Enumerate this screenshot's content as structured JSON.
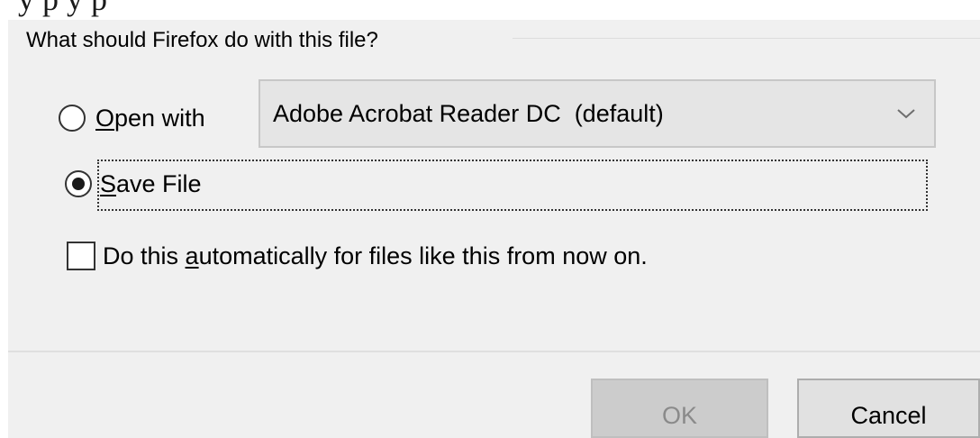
{
  "top_fragment": "            y                                                   p    y          p",
  "dialog": {
    "group_title": "What should Firefox do with this file?",
    "open_with": {
      "mnemonic": "O",
      "rest": "pen with",
      "selected": false,
      "app_value": "Adobe Acrobat Reader DC  (default)",
      "chevron_icon": "chevron-down-icon"
    },
    "save_file": {
      "mnemonic": "S",
      "rest": "ave File",
      "selected": true
    },
    "auto": {
      "before": "Do this ",
      "mnemonic": "a",
      "after": "utomatically for files like this from now on.",
      "checked": false
    },
    "buttons": {
      "ok_label": "OK",
      "ok_enabled": false,
      "cancel_label": "Cancel"
    }
  },
  "colors": {
    "dialog_bg": "#f0f0f0",
    "dropdown_bg": "#e5e5e5",
    "ok_disabled_bg": "#cccccc",
    "ok_disabled_text": "#8a8a8a",
    "cancel_bg": "#e1e1e1"
  }
}
